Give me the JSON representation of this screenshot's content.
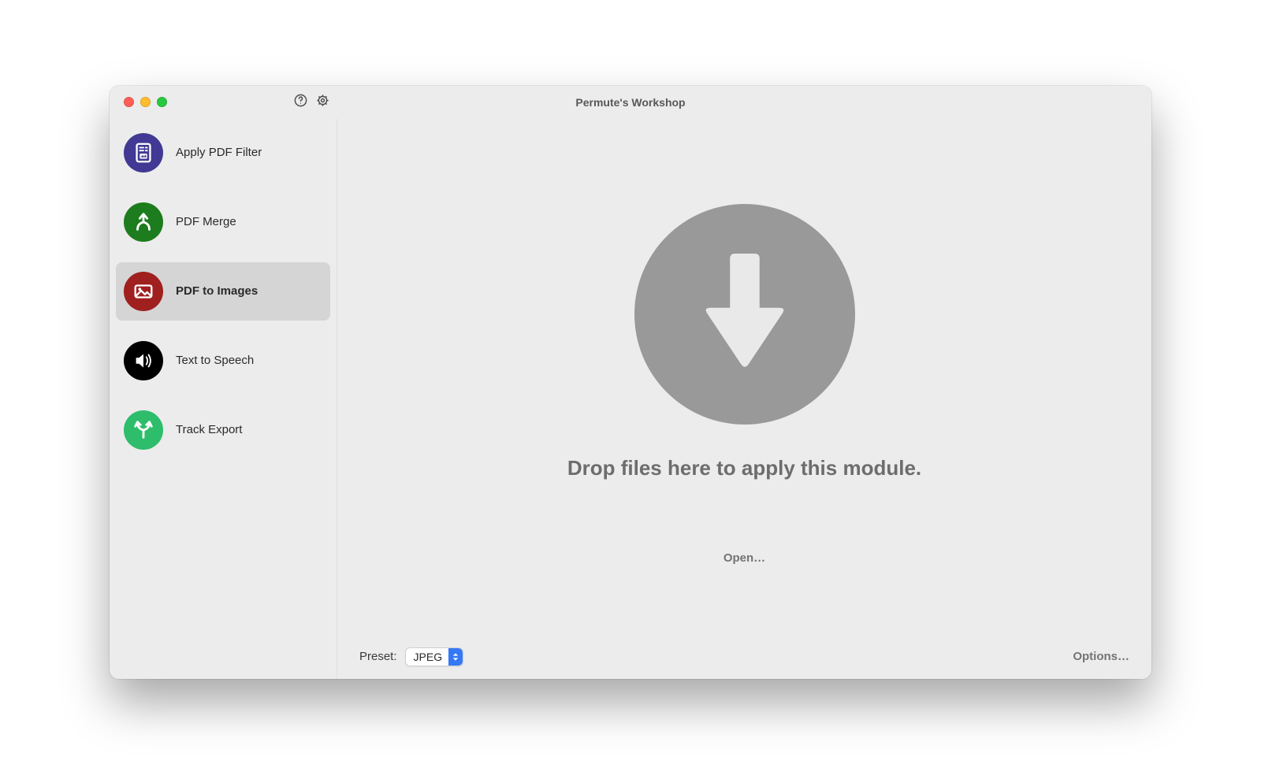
{
  "window": {
    "title": "Permute's Workshop"
  },
  "sidebar": {
    "items": [
      {
        "label": "Apply PDF Filter",
        "icon": "pdf-filter-icon",
        "color": "#413993",
        "selected": false
      },
      {
        "label": "PDF Merge",
        "icon": "merge-icon",
        "color": "#1d7c1d",
        "selected": false
      },
      {
        "label": "PDF to Images",
        "icon": "image-icon",
        "color": "#a01f1f",
        "selected": true
      },
      {
        "label": "Text to Speech",
        "icon": "speaker-icon",
        "color": "#000000",
        "selected": false
      },
      {
        "label": "Track Export",
        "icon": "split-icon",
        "color": "#2ebd6b",
        "selected": false
      }
    ]
  },
  "main": {
    "drop_text": "Drop files here to apply this module.",
    "open_button": "Open…",
    "preset_label": "Preset:",
    "preset_value": "JPEG",
    "options_button": "Options…"
  }
}
